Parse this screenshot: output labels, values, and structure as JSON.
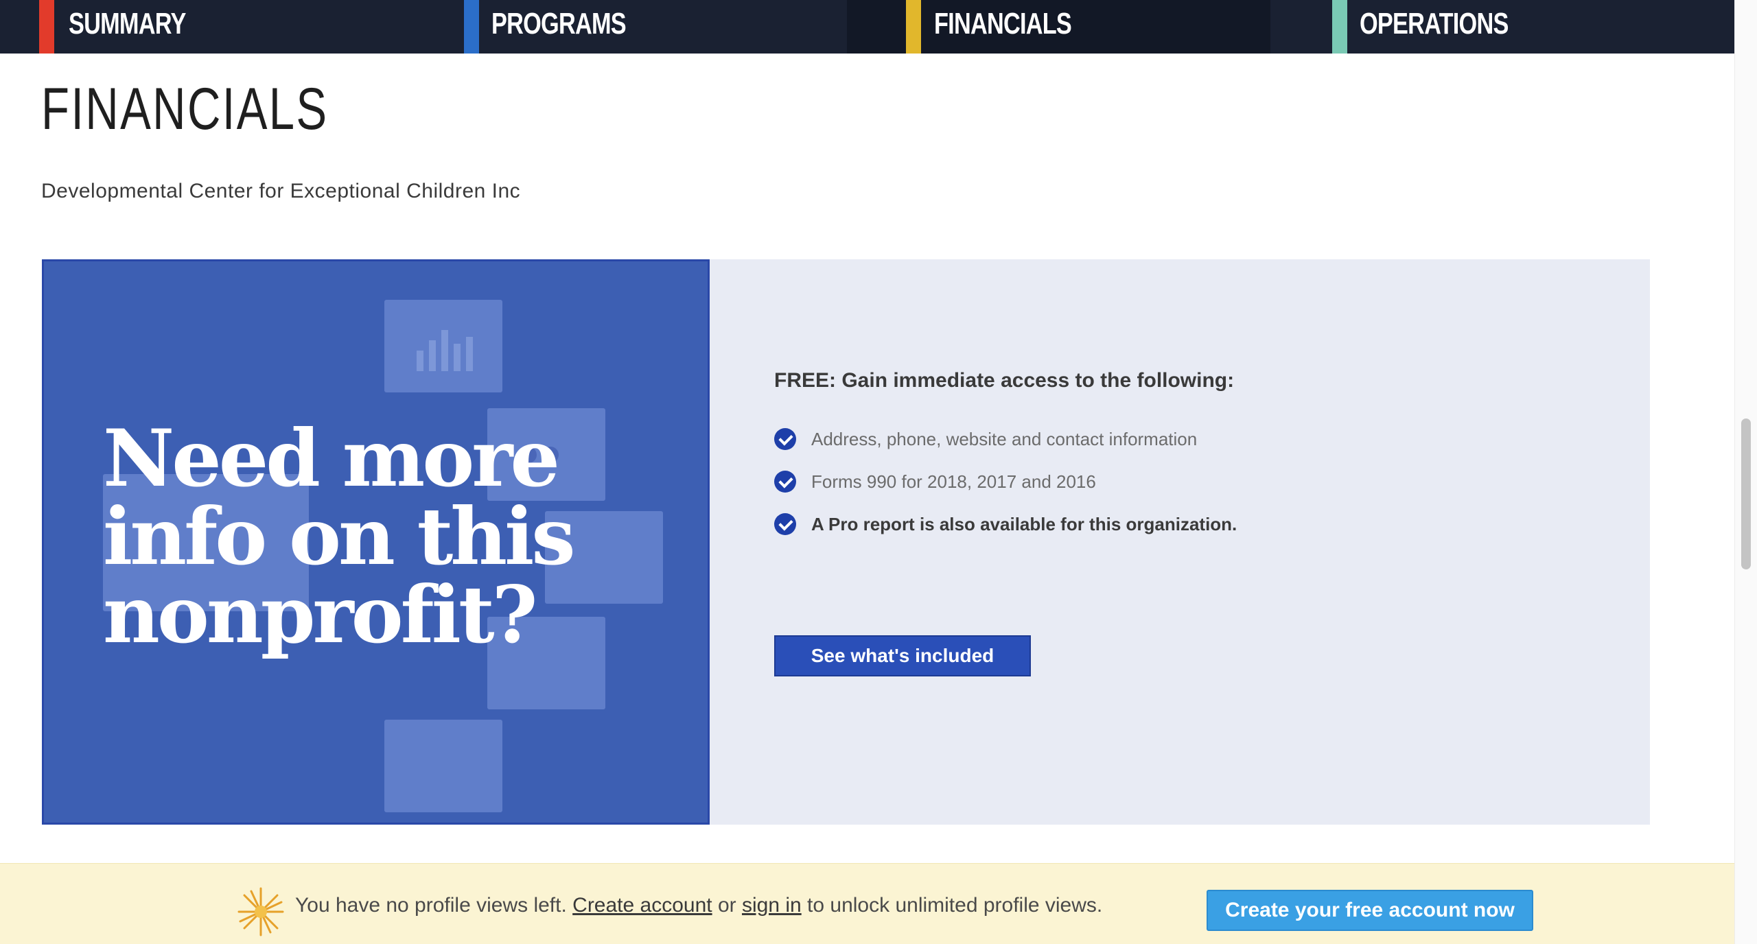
{
  "nav": {
    "tabs": [
      {
        "label": "SUMMARY",
        "color": "#e23b2b",
        "active": false
      },
      {
        "label": "PROGRAMS",
        "color": "#2b6ec9",
        "active": false
      },
      {
        "label": "FINANCIALS",
        "color": "#e1b72c",
        "active": true
      },
      {
        "label": "OPERATIONS",
        "color": "#7ac9b4",
        "active": false
      }
    ]
  },
  "page": {
    "title": "FINANCIALS",
    "org_name": "Developmental Center for Exceptional Children Inc"
  },
  "promo": {
    "headline": "Need more info on this nonprofit?",
    "free_heading": "FREE: Gain immediate access to the following:",
    "bullets": [
      "Address, phone, website and contact information",
      "Forms 990 for 2018, 2017 and 2016",
      "A Pro report is also available for this organization."
    ],
    "cta_label": "See what's included"
  },
  "banner": {
    "text_before": "You have no profile views left.",
    "create_link": "Create account",
    "or_text": "or",
    "signin_link": "sign in",
    "text_after": "to unlock unlimited profile views.",
    "button_label": "Create your free account now",
    "icon": "sparkle-icon"
  }
}
